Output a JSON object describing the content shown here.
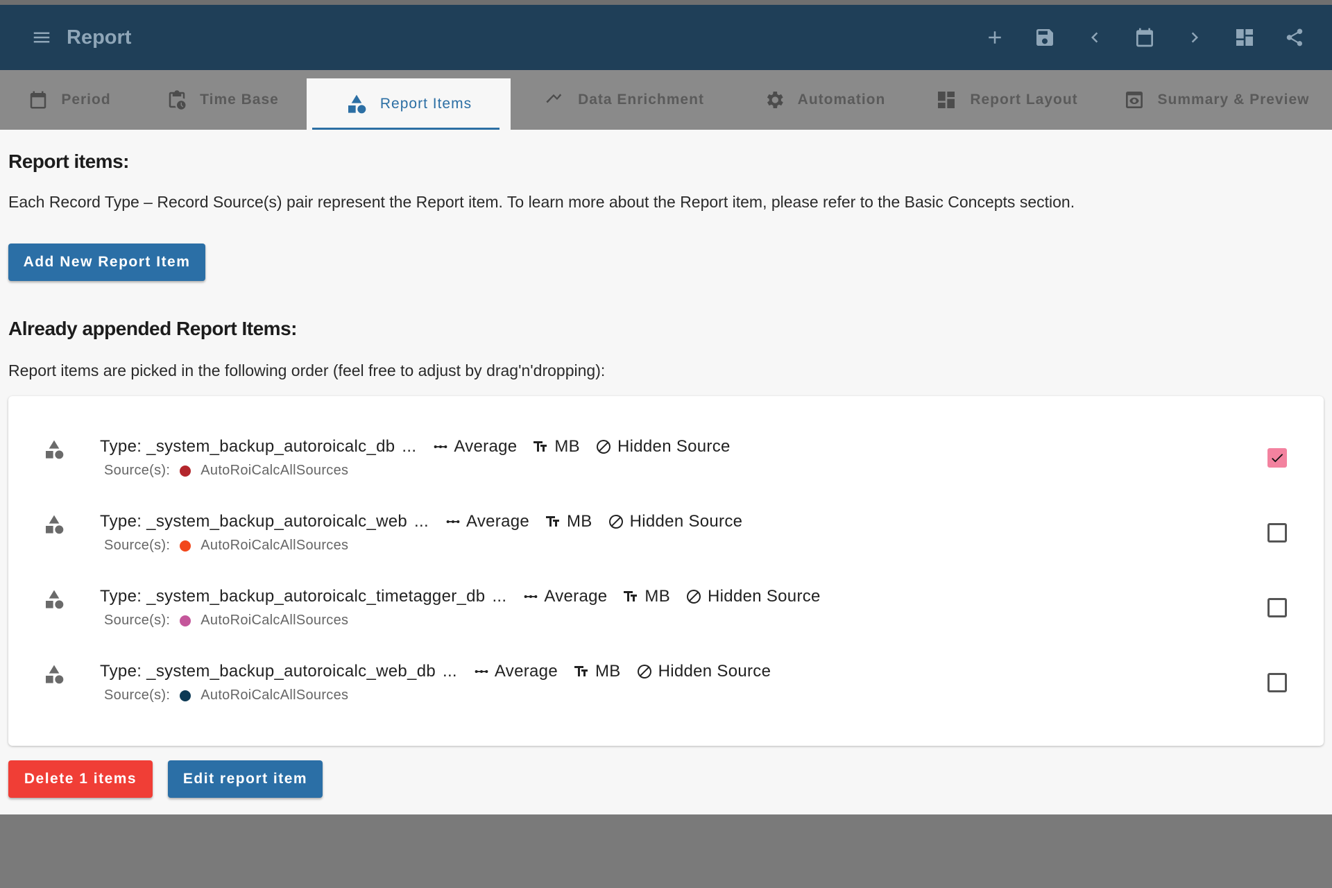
{
  "app": {
    "title": "Report"
  },
  "toolbar_icons": [
    "add-icon",
    "save-icon",
    "chevron-left-icon",
    "calendar-icon",
    "chevron-right-icon",
    "dashboard-icon",
    "share-icon"
  ],
  "tabs": [
    {
      "label": "Period",
      "icon": "calendar-icon",
      "active": false
    },
    {
      "label": "Time Base",
      "icon": "clipboard-clock-icon",
      "active": false
    },
    {
      "label": "Report Items",
      "icon": "shapes-icon",
      "active": true
    },
    {
      "label": "Data Enrichment",
      "icon": "trending-icon",
      "active": false
    },
    {
      "label": "Automation",
      "icon": "gear-icon",
      "active": false
    },
    {
      "label": "Report Layout",
      "icon": "dashboard-icon",
      "active": false
    },
    {
      "label": "Summary & Preview",
      "icon": "preview-icon",
      "active": false
    }
  ],
  "main": {
    "heading": "Report items:",
    "description": "Each Record Type – Record Source(s) pair represent the Report item. To learn more about the Report item, please refer to the Basic Concepts section.",
    "add_button": "Add New Report Item",
    "appended_heading": "Already appended Report Items:",
    "order_text": "Report items are picked in the following order (feel free to adjust by drag'n'dropping):"
  },
  "items": [
    {
      "type": "Type: _system_backup_autoroicalc_db",
      "ellipsis": "...",
      "aggregation": "Average",
      "unit": "MB",
      "visibility": "Hidden Source",
      "sources_label": "Source(s):",
      "source": "AutoRoiCalcAllSources",
      "color": "#b3262c",
      "checked": true
    },
    {
      "type": "Type: _system_backup_autoroicalc_web",
      "ellipsis": "...",
      "aggregation": "Average",
      "unit": "MB",
      "visibility": "Hidden Source",
      "sources_label": "Source(s):",
      "source": "AutoRoiCalcAllSources",
      "color": "#f2471b",
      "checked": false
    },
    {
      "type": "Type: _system_backup_autoroicalc_timetagger_db",
      "ellipsis": "...",
      "aggregation": "Average",
      "unit": "MB",
      "visibility": "Hidden Source",
      "sources_label": "Source(s):",
      "source": "AutoRoiCalcAllSources",
      "color": "#c4569a",
      "checked": false
    },
    {
      "type": "Type: _system_backup_autoroicalc_web_db",
      "ellipsis": "...",
      "aggregation": "Average",
      "unit": "MB",
      "visibility": "Hidden Source",
      "sources_label": "Source(s):",
      "source": "AutoRoiCalcAllSources",
      "color": "#0d3a55",
      "checked": false
    }
  ],
  "footer": {
    "delete_button": "Delete 1 items",
    "edit_button": "Edit report item"
  }
}
